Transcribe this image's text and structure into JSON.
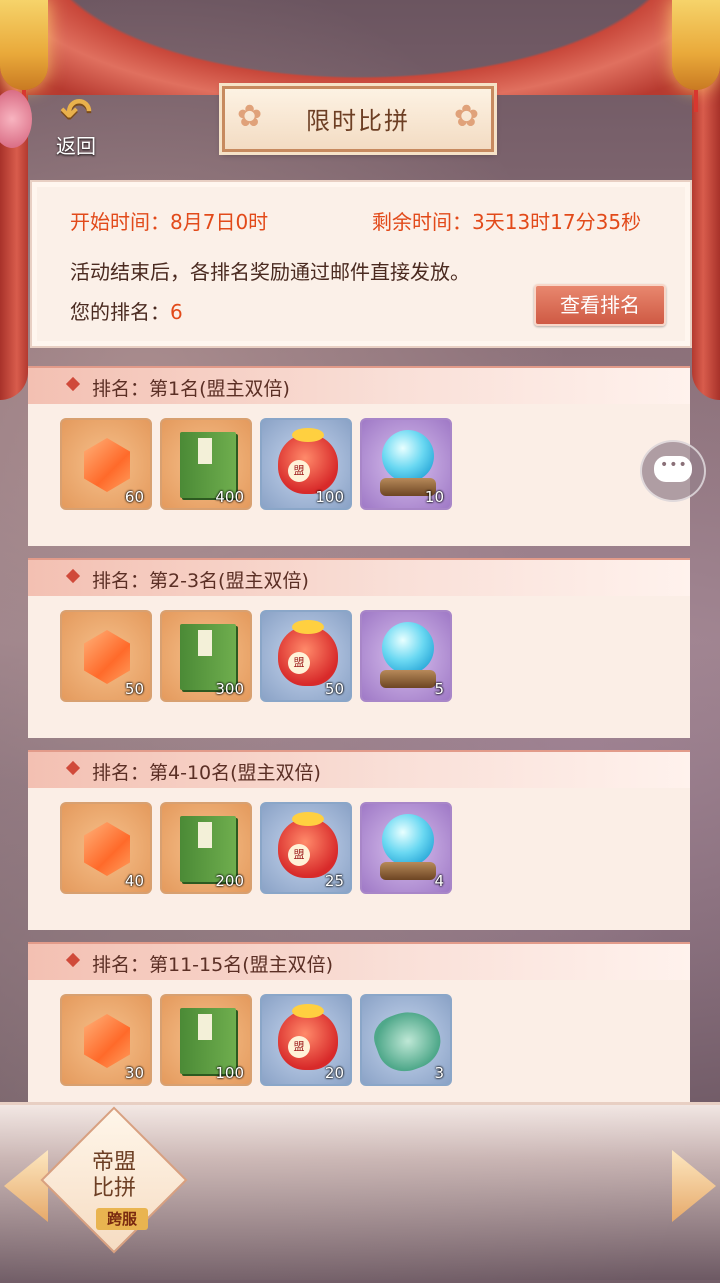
{
  "header": {
    "title": "限时比拼",
    "back_label": "返回"
  },
  "info": {
    "start_time": "开始时间：8月7日0时",
    "remaining_time": "剩余时间：3天13时17分35秒",
    "notice": "活动结束后，各排名奖励通过邮件直接发放。",
    "my_rank_label": "您的排名：",
    "my_rank_value": "6",
    "view_rank_button": "查看排名"
  },
  "ranks": [
    {
      "title": "排名：第1名(盟主双倍)",
      "rewards": [
        {
          "icon": "orange-crystal-icon",
          "count": "60"
        },
        {
          "icon": "green-book-icon",
          "count": "400"
        },
        {
          "icon": "treasure-bag-icon",
          "count": "100"
        },
        {
          "icon": "blue-orb-icon",
          "count": "10"
        }
      ]
    },
    {
      "title": "排名：第2-3名(盟主双倍)",
      "rewards": [
        {
          "icon": "orange-crystal-icon",
          "count": "50"
        },
        {
          "icon": "green-book-icon",
          "count": "300"
        },
        {
          "icon": "treasure-bag-icon",
          "count": "50"
        },
        {
          "icon": "blue-orb-icon",
          "count": "5"
        }
      ]
    },
    {
      "title": "排名：第4-10名(盟主双倍)",
      "rewards": [
        {
          "icon": "orange-crystal-icon",
          "count": "40"
        },
        {
          "icon": "green-book-icon",
          "count": "200"
        },
        {
          "icon": "treasure-bag-icon",
          "count": "25"
        },
        {
          "icon": "blue-orb-icon",
          "count": "4"
        }
      ]
    },
    {
      "title": "排名：第11-15名(盟主双倍)",
      "rewards": [
        {
          "icon": "orange-crystal-icon",
          "count": "30"
        },
        {
          "icon": "green-book-icon",
          "count": "100"
        },
        {
          "icon": "treasure-bag-icon",
          "count": "20"
        },
        {
          "icon": "jade-pendant-icon",
          "count": "3"
        }
      ]
    }
  ],
  "bottom_tab": {
    "line1": "帝盟",
    "line2": "比拼",
    "tag": "跨服"
  }
}
